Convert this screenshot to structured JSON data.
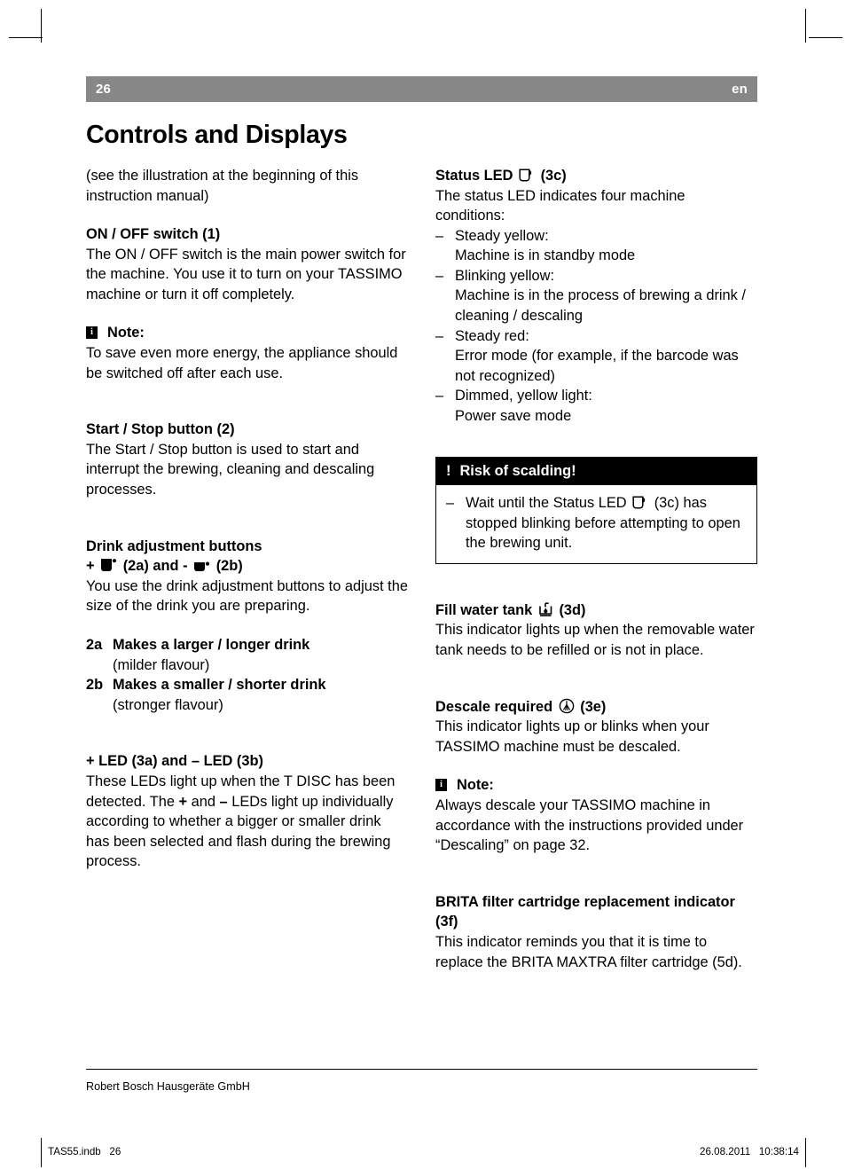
{
  "header": {
    "page_number": "26",
    "language": "en",
    "band_color": "#878787"
  },
  "title": "Controls and Displays",
  "left_column": {
    "intro": "(see the illustration at the beginning of this instruction manual)",
    "onoff": {
      "heading": "ON / OFF switch (1)",
      "body": "The ON / OFF switch is the main power switch for the machine. You use it to turn on your TASSIMO machine or turn it off completely."
    },
    "note1": {
      "icon": "info-square-icon",
      "icon_glyph": "i",
      "label": "Note:",
      "body": "To save even more energy, the appliance should be switched off after each use."
    },
    "startstop": {
      "heading": "Start / Stop button (2)",
      "body": "The Start / Stop button is used to start and interrupt the brewing, cleaning and descaling processes."
    },
    "drink_adjust": {
      "heading_line1": "Drink adjustment buttons",
      "plus_sign": "+",
      "cup_large_icon": "cup-large-filled-icon",
      "ref_2a": "(2a) and",
      "minus_sign": "-",
      "cup_small_icon": "cup-small-filled-icon",
      "ref_2b": "(2b)",
      "body": "You use the drink adjustment buttons to adjust the size of the drink you are preparing."
    },
    "size_list": [
      {
        "key": "2a",
        "label": "Makes a larger / longer drink",
        "sub": "(milder flavour)"
      },
      {
        "key": "2b",
        "label": "Makes a smaller / shorter drink",
        "sub": "(stronger flavour)"
      }
    ],
    "leds": {
      "heading_plus": "+",
      "heading_mid": "LED (3a) and",
      "heading_minus": "–",
      "heading_end": "LED (3b)",
      "body_part1": "These LEDs light up when the T DISC has been detected. The ",
      "body_plus": "+",
      "body_part2": " and ",
      "body_minus": "–",
      "body_part3": " LEDs light up individually according to whether a bigger or smaller drink has been selected and flash during the brewing process."
    }
  },
  "right_column": {
    "status_led": {
      "heading_pre": "Status LED",
      "icon": "cup-outline-icon",
      "heading_ref": "(3c)",
      "body": "The status LED indicates four machine conditions:",
      "conditions": [
        {
          "dash": "–",
          "title": "Steady yellow:",
          "detail": "Machine is in standby mode"
        },
        {
          "dash": "–",
          "title": "Blinking yellow:",
          "detail": "Machine is in the process of brewing a drink / cleaning / descaling"
        },
        {
          "dash": "–",
          "title": "Steady red:",
          "detail": "Error mode (for example, if the barcode was not recognized)"
        },
        {
          "dash": "–",
          "title": "Dimmed, yellow light:",
          "detail": "Power save mode"
        }
      ]
    },
    "warning": {
      "bang": "!",
      "title": "Risk of scalding!",
      "dash": "–",
      "body_pre": "Wait until the Status LED",
      "icon": "cup-outline-icon",
      "body_post": "(3c) has stopped blinking before attempting to open the brewing unit."
    },
    "fill_water": {
      "heading_pre": "Fill water tank",
      "icon": "water-tank-icon",
      "heading_ref": "(3d)",
      "body": "This indicator lights up when the removable water tank needs to be refilled or is not in place."
    },
    "descale": {
      "heading_pre": "Descale required",
      "icon": "descale-circle-icon",
      "heading_ref": "(3e)",
      "body": "This indicator lights up or blinks when your TASSIMO machine must be descaled."
    },
    "note2": {
      "icon": "info-square-icon",
      "icon_glyph": "i",
      "label": "Note:",
      "body": "Always descale your TASSIMO machine in accordance with the instructions provided under “Descaling” on page 32."
    },
    "brita": {
      "heading": "BRITA filter cartridge replacement indicator (3f)",
      "body": "This indicator reminds you that it is time to replace the BRITA MAXTRA filter cartridge (5d)."
    }
  },
  "footer": {
    "company": "Robert Bosch Hausgeräte GmbH",
    "file_ref": "TAS55.indb   26",
    "timestamp": "26.08.2011   10:38:14"
  }
}
